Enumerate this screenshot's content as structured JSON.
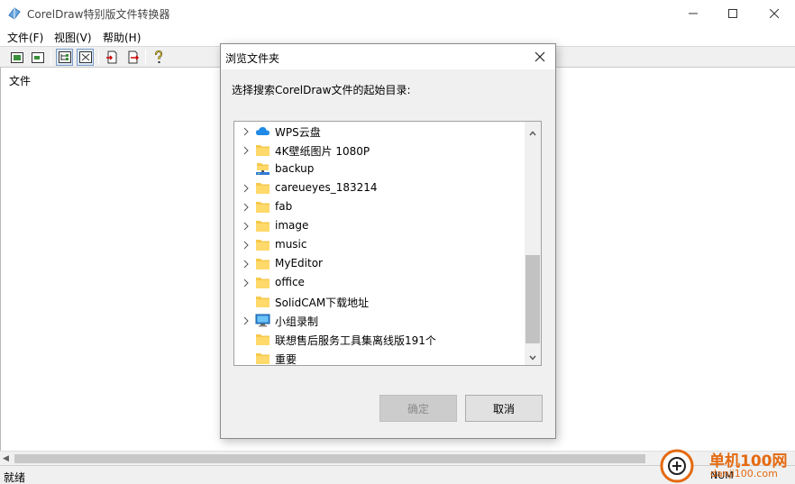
{
  "window": {
    "title": "CorelDraw特别版文件转换器",
    "icon": "coreldraw-app-icon"
  },
  "menu": [
    {
      "label": "文件(F)"
    },
    {
      "label": "视图(V)"
    },
    {
      "label": "帮助(H)"
    }
  ],
  "toolbar": {
    "icons": [
      "view-large-icon",
      "view-small-icon",
      "tree-view-icon",
      "clear-view-icon",
      "import-icon",
      "export-icon",
      "help-icon"
    ]
  },
  "workspace": {
    "label": "文件"
  },
  "status": {
    "text": "就绪",
    "num": "NUM"
  },
  "watermark": {
    "text": "单机100网",
    "sub": "danji100.com"
  },
  "dialog": {
    "title": "浏览文件夹",
    "prompt": "选择搜索CorelDraw文件的起始目录:",
    "ok_label": "确定",
    "cancel_label": "取消",
    "items": [
      {
        "label": "WPS云盘",
        "icon": "cloud-icon",
        "expandable": true
      },
      {
        "label": "4K壁纸图片 1080P",
        "icon": "folder-icon",
        "expandable": true
      },
      {
        "label": "backup",
        "icon": "network-folder-icon",
        "expandable": false
      },
      {
        "label": "careueyes_183214",
        "icon": "folder-icon",
        "expandable": true
      },
      {
        "label": "fab",
        "icon": "folder-icon",
        "expandable": true
      },
      {
        "label": "image",
        "icon": "folder-icon",
        "expandable": true
      },
      {
        "label": "music",
        "icon": "folder-icon",
        "expandable": true
      },
      {
        "label": "MyEditor",
        "icon": "folder-icon",
        "expandable": true
      },
      {
        "label": "office",
        "icon": "folder-icon",
        "expandable": true
      },
      {
        "label": "SolidCAM下载地址",
        "icon": "folder-icon",
        "expandable": false
      },
      {
        "label": "小组录制",
        "icon": "computer-icon",
        "expandable": true
      },
      {
        "label": "联想售后服务工具集离线版191个",
        "icon": "folder-icon",
        "expandable": false
      },
      {
        "label": "重要",
        "icon": "folder-icon",
        "expandable": false
      }
    ]
  }
}
